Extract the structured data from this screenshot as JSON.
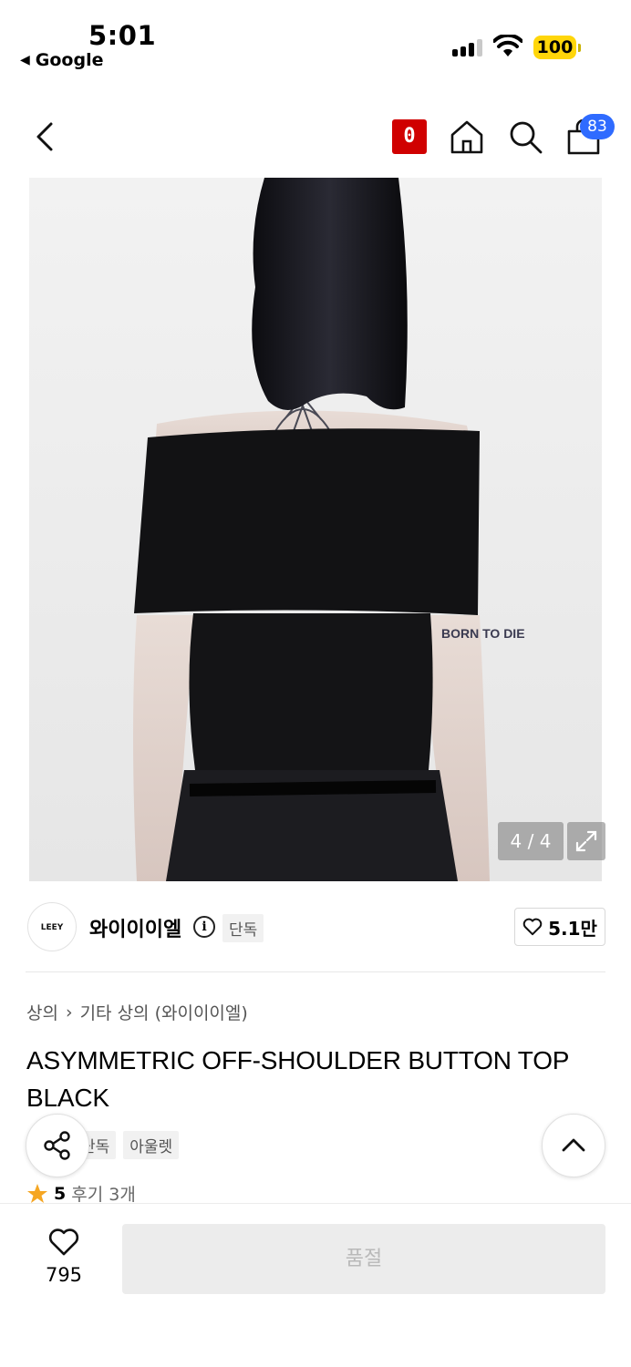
{
  "status_bar": {
    "time": "5:01",
    "back_app": "Google",
    "battery": "100"
  },
  "nav": {
    "brand_badge": "0",
    "cart_count": "83"
  },
  "gallery": {
    "counter": "4 / 4",
    "tattoo_text": "BORN TO DIE"
  },
  "brand": {
    "logo_text": "LEEY",
    "name": "와이이이엘",
    "tag": "단독",
    "like_count": "5.1만"
  },
  "breadcrumb": {
    "category": "상의",
    "subcategory": "기타 상의 (와이이이엘)"
  },
  "product": {
    "title": "ASYMMETRIC OFF-SHOULDER BUTTON TOP BLACK",
    "tags": [
      "단독",
      "아울렛"
    ],
    "rating": "5",
    "reviews": "후기 3개"
  },
  "bottom_bar": {
    "wish_count": "795",
    "buy_label": "품절"
  },
  "colors": {
    "brand_red": "#d00000",
    "cart_badge_blue": "#2f6bff",
    "battery_yellow": "#ffd60a",
    "star_orange": "#f5a623"
  }
}
